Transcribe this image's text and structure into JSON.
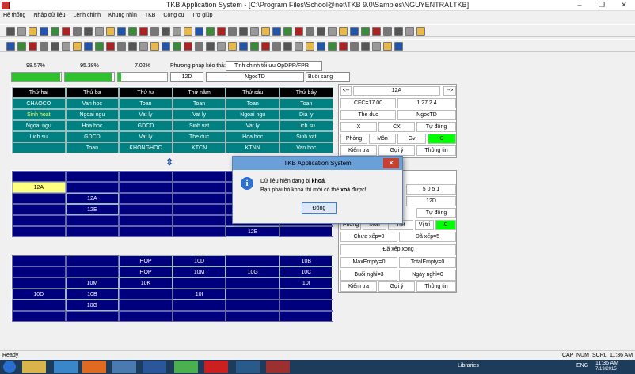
{
  "window": {
    "title": "TKB Application System - [C:\\Program Files\\School@net\\TKB 9.0\\Samples\\NGUYENTRAI.TKB]",
    "min": "–",
    "restore": "❐",
    "close": "✕"
  },
  "menu": [
    "Hệ thống",
    "Nhập dữ liệu",
    "Lệnh chính",
    "Khung nhìn",
    "TKB",
    "Công cụ",
    "Trợ giúp"
  ],
  "progress": {
    "p1": "98.57%",
    "p2": "95.38%",
    "p3": "7.02%",
    "v1": 0.9857,
    "v2": 0.9538,
    "v3": 0.0702
  },
  "drag": {
    "label": "Phương pháp kéo thả:",
    "value": "Tinh chinh tối ưu OpDPR/FPR"
  },
  "fields": {
    "class": "12D",
    "teacher": "NgocTD",
    "session": "Buổi sáng"
  },
  "days": [
    "Thứ hai",
    "Thứ ba",
    "Thứ tư",
    "Thứ năm",
    "Thứ sáu",
    "Thứ bảy"
  ],
  "schedule": [
    [
      "CHAOCO",
      "Van hoc",
      "Toan",
      "Toan",
      "Toan",
      "Toan"
    ],
    [
      "Sinh hoat",
      "Ngoai ngu",
      "Vat ly",
      "Vat ly",
      "Ngoai ngu",
      "Dia ly"
    ],
    [
      "Ngoai ngu",
      "Hoa hoc",
      "GDCD",
      "Sinh vat",
      "Vat ly",
      "Lich su"
    ],
    [
      "Lich su",
      "GDCD",
      "Vat ly",
      "The duc",
      "Hoa hoc",
      "Sinh vat"
    ],
    [
      "",
      "Toan",
      "KHONGHOC",
      "KTCN",
      "KTNN",
      "Van hoc"
    ]
  ],
  "grid2": {
    "a": "12A",
    "b": "12A",
    "c": "12E",
    "d": "12E"
  },
  "grid3": [
    "HOP",
    "10D",
    "10B",
    "HOP",
    "10M",
    "10G",
    "10C",
    "10M",
    "10K",
    "10I",
    "10D",
    "10B",
    "10I",
    "10G"
  ],
  "panel1": {
    "nav_prev": "<--",
    "nav_next": "-->",
    "class": "12A",
    "cfc": "CFC=17.00",
    "code": "1 27 2 4",
    "subj": "The duc",
    "teacher": "NgocTD",
    "x": "X",
    "cx": "CX",
    "auto": "Tự động",
    "phong": "Phòng",
    "mon": "Môn",
    "gv": "Gv",
    "c": "C",
    "check": "Kiểm tra",
    "hint": "Gợi ý",
    "info": "Thông tin"
  },
  "panel2": {
    "code": "5 0 5 1",
    "cls": "12D",
    "auto": "Tự động",
    "phong": "Phòng",
    "mon": "Môn",
    "tiet": "Tiet",
    "vitri": "Vị trí",
    "c": "C",
    "unsched": "Chưa xếp=0",
    "sched": "Đã xếp=5",
    "done": "Đã xếp xong",
    "maxempty": "MaxEmpty=0",
    "totalempty": "TotalEmpty=0",
    "buoinghi": "Buổi nghỉ=3",
    "ngaynghi": "Ngày nghỉ=0",
    "check": "Kiểm tra",
    "hint": "Gợi ý",
    "info": "Thông tin"
  },
  "dialog": {
    "title": "TKB Application System",
    "line1a": "Dữ liệu hiện đang bị ",
    "line1b": "khoá",
    "line1c": ".",
    "line2a": "Bạn phải bỏ khoá thì mới có  thể ",
    "line2b": "xoá",
    "line2c": " được!",
    "ok": "Đóng"
  },
  "status": {
    "ready": "Ready",
    "cap": "CAP",
    "num": "NUM",
    "scrl": "SCRL",
    "time": "11:36 AM"
  },
  "taskbar": {
    "libraries": "Libraries",
    "lang": "ENG",
    "time": "11:36 AM",
    "date": "7/19/2015"
  }
}
